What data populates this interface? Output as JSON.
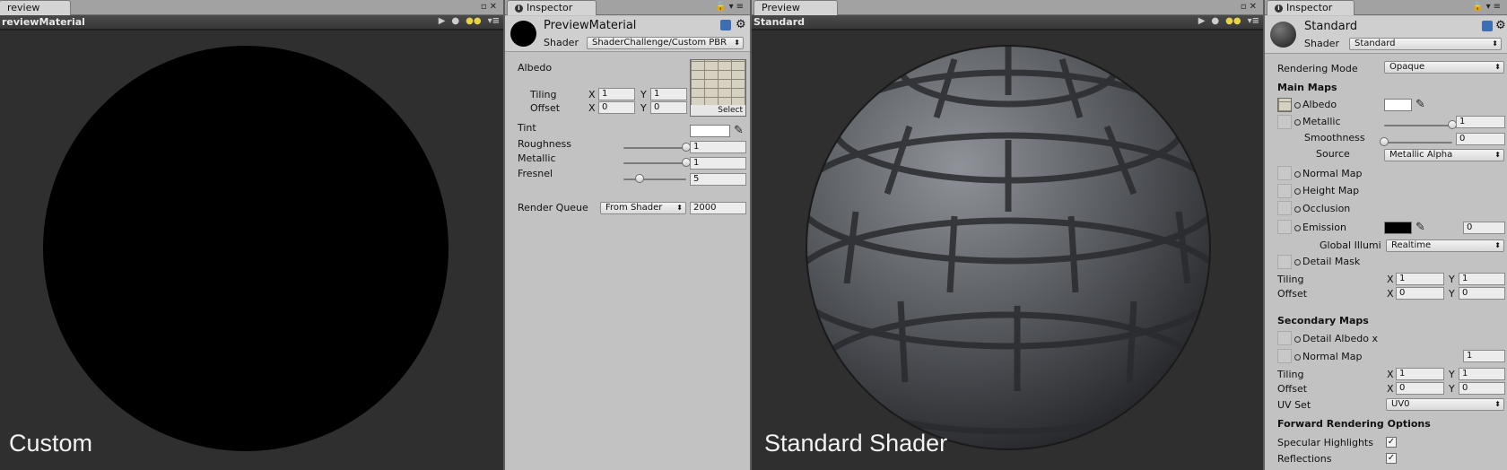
{
  "preview_left": {
    "tab_label": "review",
    "title": "reviewMaterial",
    "caption": "Custom"
  },
  "inspector_left": {
    "tab_label": "Inspector",
    "material_name": "PreviewMaterial",
    "shader_label": "Shader",
    "shader_value": "ShaderChallenge/Custom PBR",
    "albedo_label": "Albedo",
    "tiling_label": "Tiling",
    "offset_label": "Offset",
    "x_label": "X",
    "y_label": "Y",
    "tiling_x": "1",
    "tiling_y": "1",
    "offset_x": "0",
    "offset_y": "0",
    "select_label": "Select",
    "tint_label": "Tint",
    "roughness_label": "Roughness",
    "roughness_value": "1",
    "metallic_label": "Metallic",
    "metallic_value": "1",
    "fresnel_label": "Fresnel",
    "fresnel_value": "5",
    "render_queue_label": "Render Queue",
    "render_queue_mode": "From Shader",
    "render_queue_value": "2000",
    "roughness_slider": 1.0,
    "metallic_slider": 1.0,
    "fresnel_slider": 0.25
  },
  "preview_right": {
    "tab_label": "Preview",
    "title": "Standard",
    "caption": "Standard Shader"
  },
  "inspector_right": {
    "tab_label": "Inspector",
    "material_name": "Standard",
    "shader_label": "Shader",
    "shader_value": "Standard",
    "rendering_mode_label": "Rendering Mode",
    "rendering_mode_value": "Opaque",
    "main_maps_label": "Main Maps",
    "albedo_label": "Albedo",
    "metallic_label": "Metallic",
    "metallic_value": "1",
    "smoothness_label": "Smoothness",
    "smoothness_value": "0",
    "source_label": "Source",
    "source_value": "Metallic Alpha",
    "normal_map_label": "Normal Map",
    "height_map_label": "Height Map",
    "occlusion_label": "Occlusion",
    "emission_label": "Emission",
    "emission_value": "0",
    "global_illum_label": "Global Illumi",
    "global_illum_value": "Realtime",
    "detail_mask_label": "Detail Mask",
    "tiling_label": "Tiling",
    "offset_label": "Offset",
    "x_label": "X",
    "y_label": "Y",
    "tiling_x": "1",
    "tiling_y": "1",
    "offset_x": "0",
    "offset_y": "0",
    "secondary_maps_label": "Secondary Maps",
    "detail_albedo_label": "Detail Albedo x",
    "normal_map2_label": "Normal Map",
    "normal_map2_value": "1",
    "tiling2_x": "1",
    "tiling2_y": "1",
    "offset2_x": "0",
    "offset2_y": "0",
    "uv_set_label": "UV Set",
    "uv_set_value": "UV0",
    "forward_label": "Forward Rendering Options",
    "specular_label": "Specular Highlights",
    "reflections_label": "Reflections",
    "check_mark": "✓",
    "metallic_slider": 1.0,
    "smoothness_slider": 0.0
  },
  "colors": {
    "inspector_bg": "#c2c2c2",
    "viewport_bg": "#2f2f2f",
    "tab_bar": "#a2a2a2"
  }
}
